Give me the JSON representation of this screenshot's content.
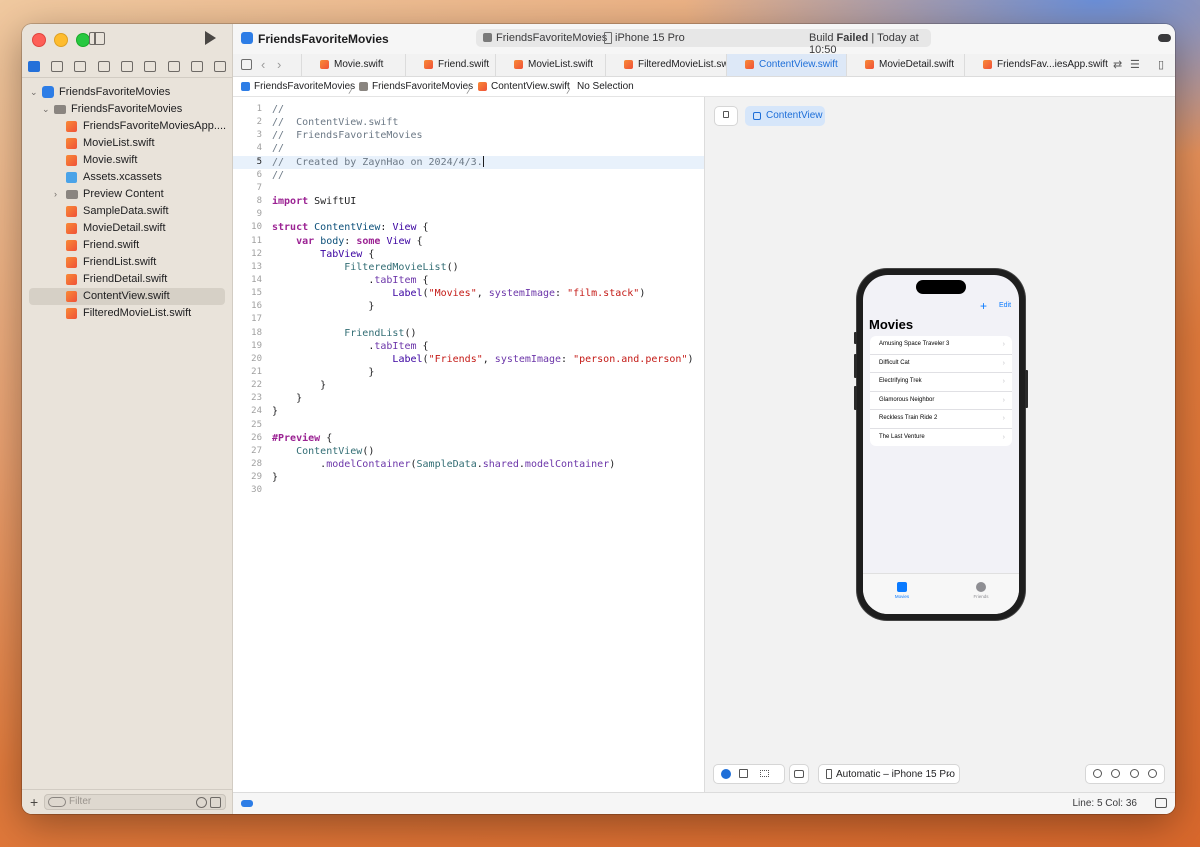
{
  "toolbar": {
    "project_title": "FriendsFavoriteMovies",
    "scheme_name": "FriendsFavoriteMovies",
    "destination": "iPhone 15 Pro",
    "build_status_word": "Build",
    "build_status_bold": "Failed",
    "build_time": "| Today at 10:50"
  },
  "navigator": {
    "tree": [
      {
        "label": "FriendsFavoriteMovies",
        "kind": "project",
        "level": 0,
        "chevron": "open"
      },
      {
        "label": "FriendsFavoriteMovies",
        "kind": "folder",
        "level": 1,
        "chevron": "open"
      },
      {
        "label": "FriendsFavoriteMoviesApp....",
        "kind": "swift",
        "level": 2
      },
      {
        "label": "MovieList.swift",
        "kind": "swift",
        "level": 2
      },
      {
        "label": "Movie.swift",
        "kind": "swift",
        "level": 2
      },
      {
        "label": "Assets.xcassets",
        "kind": "assets",
        "level": 2
      },
      {
        "label": "Preview Content",
        "kind": "folder",
        "level": 2,
        "chevron": "closed"
      },
      {
        "label": "SampleData.swift",
        "kind": "swift",
        "level": 2
      },
      {
        "label": "MovieDetail.swift",
        "kind": "swift",
        "level": 2
      },
      {
        "label": "Friend.swift",
        "kind": "swift",
        "level": 2
      },
      {
        "label": "FriendList.swift",
        "kind": "swift",
        "level": 2
      },
      {
        "label": "FriendDetail.swift",
        "kind": "swift",
        "level": 2
      },
      {
        "label": "ContentView.swift",
        "kind": "swift",
        "level": 2,
        "selected": true
      },
      {
        "label": "FilteredMovieList.swift",
        "kind": "swift",
        "level": 2
      }
    ],
    "filter_placeholder": "Filter"
  },
  "tabs": [
    {
      "label": "Movie.swift"
    },
    {
      "label": "Friend.swift"
    },
    {
      "label": "MovieList.swift"
    },
    {
      "label": "FilteredMovieList.swift"
    },
    {
      "label": "ContentView.swift",
      "active": true
    },
    {
      "label": "MovieDetail.swift"
    },
    {
      "label": "FriendsFav...iesApp.swift"
    }
  ],
  "breadcrumb": {
    "project": "FriendsFavoriteMovies",
    "group": "FriendsFavoriteMovies",
    "file": "ContentView.swift",
    "selection": "No Selection"
  },
  "editor": {
    "highlighted_line": 5,
    "lines": [
      "//",
      "//  ContentView.swift",
      "//  FriendsFavoriteMovies",
      "//",
      "//  Created by ZaynHao on 2024/4/3.",
      "//",
      "",
      "import SwiftUI",
      "",
      "struct ContentView: View {",
      "    var body: some View {",
      "        TabView {",
      "            FilteredMovieList()",
      "                .tabItem {",
      "                    Label(\"Movies\", systemImage: \"film.stack\")",
      "                }",
      "",
      "            FriendList()",
      "                .tabItem {",
      "                    Label(\"Friends\", systemImage: \"person.and.person\")",
      "                }",
      "        }",
      "    }",
      "}",
      "",
      "#Preview {",
      "    ContentView()",
      "        .modelContainer(SampleData.shared.modelContainer)",
      "}",
      ""
    ]
  },
  "canvas": {
    "preview_chip": "ContentView",
    "device_selector": "Automatic – iPhone 15 Pro",
    "phone": {
      "nav_edit": "Edit",
      "nav_plus": "+",
      "title": "Movies",
      "movies": [
        "Amusing Space Traveler 3",
        "Difficult Cat",
        "Electrifying Trek",
        "Glamorous Neighbor",
        "Reckless Train Ride 2",
        "The Last Venture"
      ],
      "tab_movies": "Movies",
      "tab_friends": "Friends"
    }
  },
  "status": {
    "position": "Line: 5  Col: 36"
  },
  "colors": {
    "accent": "#1d6ed8",
    "ios_blue": "#0a7aff",
    "build_failed": "#1d1d1f"
  }
}
